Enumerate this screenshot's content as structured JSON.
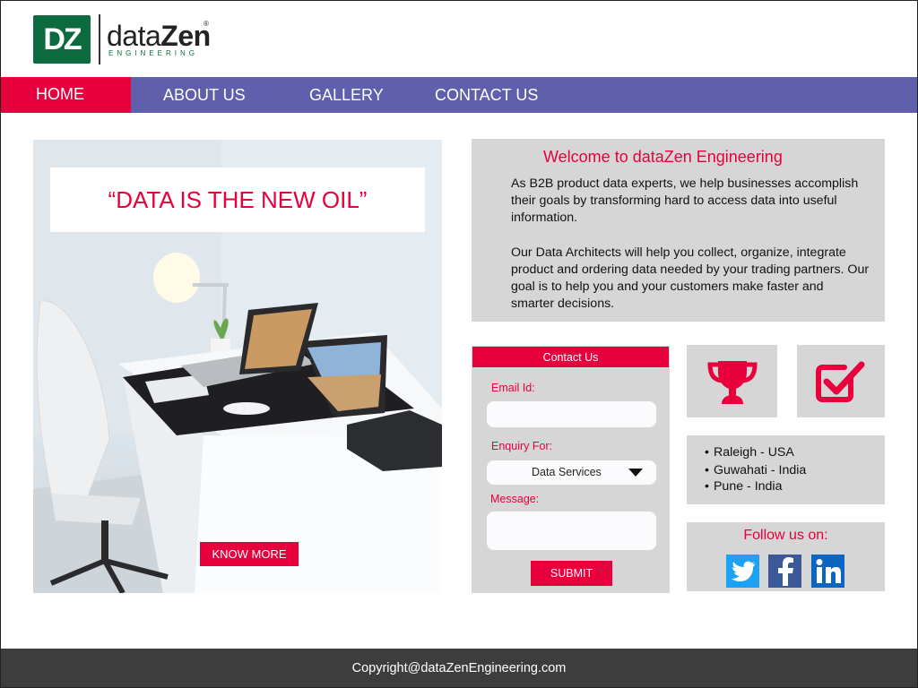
{
  "brand": {
    "logo_initials": "DZ",
    "name_light": "data",
    "name_bold": "Zen",
    "registered": "®",
    "tagline": "ENGINEERING",
    "colors": {
      "green": "#0b6b3e",
      "accent": "#e8003d",
      "nav": "#5f5fab",
      "panel": "#d6d6d6",
      "footer": "#3d3d3d"
    }
  },
  "nav": {
    "items": [
      {
        "label": "HOME",
        "active": true
      },
      {
        "label": "ABOUT US",
        "active": false
      },
      {
        "label": "GALLERY",
        "active": false
      },
      {
        "label": "CONTACT US",
        "active": false
      }
    ]
  },
  "hero": {
    "quote": "“DATA IS THE NEW OIL”",
    "button_label": "KNOW MORE"
  },
  "welcome": {
    "title": "Welcome to dataZen Engineering",
    "paragraph_1": "As B2B product data experts, we help businesses accomplish their goals by transforming hard to access data into useful information.",
    "paragraph_2": "Our Data Architects will help you collect, organize, integrate product and ordering data needed by your trading partners. Our goal is to help you and your customers make faster and smarter decisions."
  },
  "contact_form": {
    "header": "Contact Us",
    "email_label": "Email Id:",
    "email_value": "",
    "enquiry_label": "Enquiry For:",
    "enquiry_selected": "Data Services",
    "message_label": "Message:",
    "message_value": "",
    "submit_label": "SUBMIT"
  },
  "tiles": [
    {
      "icon": "trophy-icon"
    },
    {
      "icon": "checkbox-checked-icon"
    }
  ],
  "locations": [
    "Raleigh - USA",
    "Guwahati - India",
    "Pune - India"
  ],
  "social": {
    "title": "Follow us on:",
    "links": [
      {
        "icon": "twitter-icon",
        "color": "#1da1f2"
      },
      {
        "icon": "facebook-icon",
        "color": "#3b5998"
      },
      {
        "icon": "linkedin-icon",
        "color": "#0a66c2"
      }
    ]
  },
  "footer": {
    "copyright": "Copyright@dataZenEngineering.com"
  }
}
